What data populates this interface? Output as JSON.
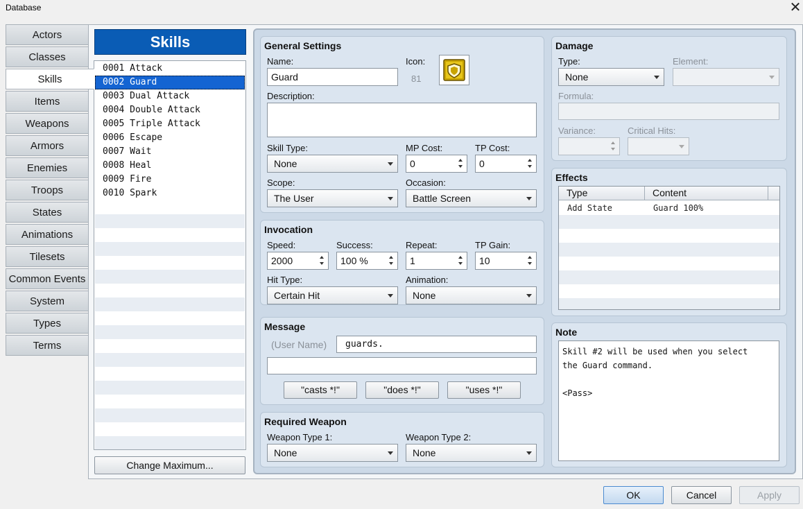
{
  "window": {
    "title": "Database"
  },
  "tabs": [
    "Actors",
    "Classes",
    "Skills",
    "Items",
    "Weapons",
    "Armors",
    "Enemies",
    "Troops",
    "States",
    "Animations",
    "Tilesets",
    "Common Events",
    "System",
    "Types",
    "Terms"
  ],
  "active_tab": "Skills",
  "list": {
    "header": "Skills",
    "items": [
      "0001 Attack",
      "0002 Guard",
      "0003 Dual Attack",
      "0004 Double Attack",
      "0005 Triple Attack",
      "0006 Escape",
      "0007 Wait",
      "0008 Heal",
      "0009 Fire",
      "0010 Spark"
    ],
    "selected": "0002 Guard",
    "change_max": "Change Maximum..."
  },
  "general": {
    "title": "General Settings",
    "name_label": "Name:",
    "name_value": "Guard",
    "icon_label": "Icon:",
    "icon_index": "81",
    "description_label": "Description:",
    "description_value": "",
    "skill_type_label": "Skill Type:",
    "skill_type_value": "None",
    "mp_cost_label": "MP Cost:",
    "mp_cost_value": "0",
    "tp_cost_label": "TP Cost:",
    "tp_cost_value": "0",
    "scope_label": "Scope:",
    "scope_value": "The User",
    "occasion_label": "Occasion:",
    "occasion_value": "Battle Screen"
  },
  "invocation": {
    "title": "Invocation",
    "speed_label": "Speed:",
    "speed_value": "2000",
    "success_label": "Success:",
    "success_value": "100 %",
    "repeat_label": "Repeat:",
    "repeat_value": "1",
    "tp_gain_label": "TP Gain:",
    "tp_gain_value": "10",
    "hit_type_label": "Hit Type:",
    "hit_type_value": "Certain Hit",
    "animation_label": "Animation:",
    "animation_value": "None"
  },
  "message": {
    "title": "Message",
    "user_name": "(User Name)",
    "line1": "guards.",
    "line2": "",
    "btn_casts": "\"casts *!\"",
    "btn_does": "\"does *!\"",
    "btn_uses": "\"uses *!\""
  },
  "required_weapon": {
    "title": "Required Weapon",
    "wt1_label": "Weapon Type 1:",
    "wt1_value": "None",
    "wt2_label": "Weapon Type 2:",
    "wt2_value": "None"
  },
  "damage": {
    "title": "Damage",
    "type_label": "Type:",
    "type_value": "None",
    "element_label": "Element:",
    "element_value": "",
    "formula_label": "Formula:",
    "formula_value": "",
    "variance_label": "Variance:",
    "variance_value": "",
    "critical_label": "Critical Hits:",
    "critical_value": ""
  },
  "effects": {
    "title": "Effects",
    "columns": [
      "Type",
      "Content"
    ],
    "rows": [
      {
        "type": "Add State",
        "content": "Guard 100%"
      }
    ]
  },
  "note": {
    "title": "Note",
    "text": "Skill #2 will be used when you select\nthe Guard command.\n\n<Pass>"
  },
  "buttons": {
    "ok": "OK",
    "cancel": "Cancel",
    "apply": "Apply"
  },
  "colors": {
    "accent": "#0a5cb5",
    "selection": "#1464d2",
    "panel": "#dbe5f0",
    "icon_gold": "#c9a400"
  }
}
